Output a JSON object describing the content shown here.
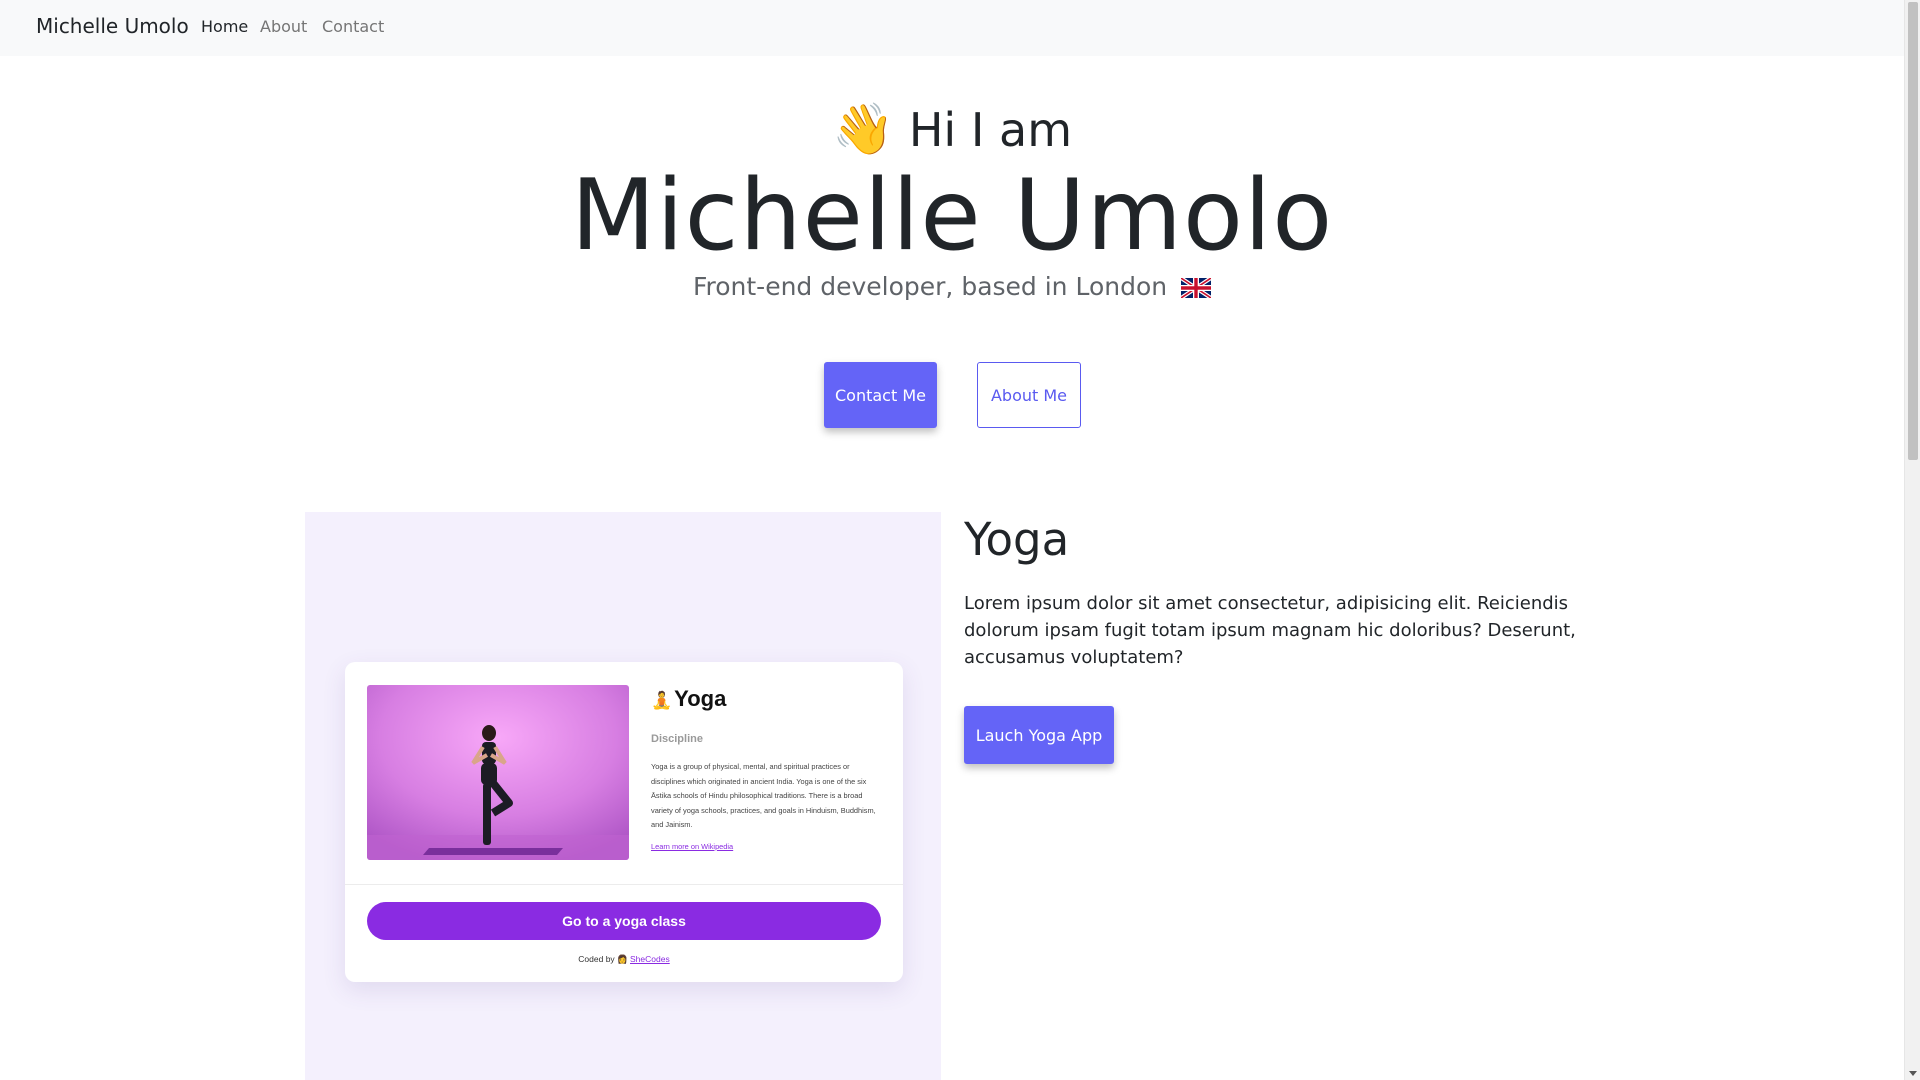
{
  "navbar": {
    "brand": "Michelle Umolo",
    "links": [
      {
        "label": "Home",
        "active": true
      },
      {
        "label": "About",
        "active": false
      },
      {
        "label": "Contact",
        "active": false
      }
    ]
  },
  "hero": {
    "wave_emoji": "👋",
    "greeting": "Hi I am",
    "name": "Michelle Umolo",
    "subtitle": "Front-end developer, based in London",
    "flag_icon": "uk-flag-icon",
    "contact_button": "Contact Me",
    "about_button": "About Me"
  },
  "project": {
    "title": "Yoga",
    "description": "Lorem ipsum dolor sit amet consectetur, adipisicing elit. Reiciendis dolorum ipsam fugit totam ipsum magnam hic doloribus? Deserunt, accusamus voluptatem?",
    "launch_button": "Lauch Yoga App",
    "preview": {
      "emoji": "🧘",
      "title": "Yoga",
      "discipline_label": "Discipline",
      "text": "Yoga is a group of physical, mental, and spiritual practices or disciplines which originated in ancient India. Yoga is one of the six Āstika schools of Hindu philosophical traditions. There is a broad variety of yoga schools, practices, and goals in Hinduism, Buddhism, and Jainism.",
      "link": "Learn more on Wikipedia",
      "class_button": "Go to a yoga class",
      "coded_by": "Coded by",
      "coder_emoji": "👩",
      "coder_link": "SheCodes"
    }
  },
  "colors": {
    "primary": "#6464f7",
    "yoga_purple": "#8a2be2",
    "panel_bg": "#f4f0fd",
    "navbar_bg": "#f8f9fa"
  }
}
